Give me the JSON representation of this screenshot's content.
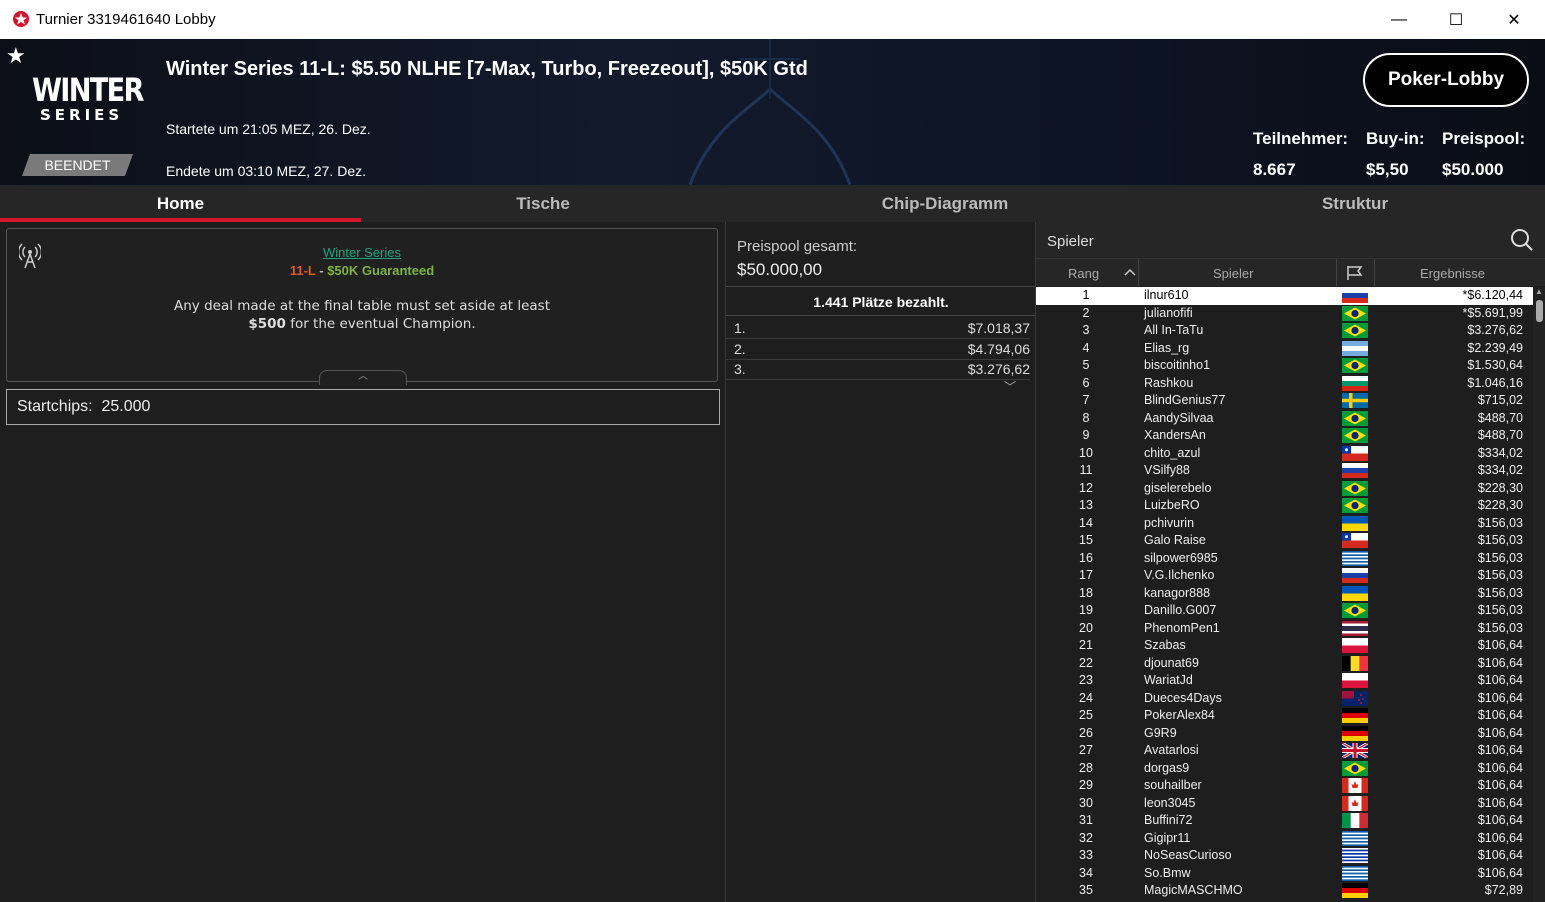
{
  "window": {
    "title": "Turnier 3319461640 Lobby",
    "minimize": "—",
    "maximize": "☐",
    "close": "✕"
  },
  "header": {
    "logo_line1": "WINTER",
    "logo_line2": "SERIES",
    "status_badge": "BEENDET",
    "tournament_title": "Winter Series 11-L: $5.50 NLHE [7-Max, Turbo, Freezeout], $50K Gtd",
    "started": "Startete um 21:05 MEZ, 26. Dez.",
    "ended": "Endete um 03:10 MEZ, 27. Dez.",
    "lobby_button": "Poker-Lobby",
    "stats": [
      {
        "label": "Teilnehmer:",
        "value": "8.667"
      },
      {
        "label": "Buy-in:",
        "value": "$5,50"
      },
      {
        "label": "Preispool:",
        "value": "$50.000"
      }
    ]
  },
  "tabs": [
    "Home",
    "Tische",
    "Chip-Diagramm",
    "Struktur"
  ],
  "home": {
    "series_link": "Winter Series",
    "event_num": "11-L",
    "sep": " - ",
    "guarantee": "$50K Guaranteed",
    "deal_line1": "Any deal made at the final table must set aside at least",
    "deal_amount": "$500",
    "deal_line2_rest": " for the eventual Champion.",
    "start_chips_label": "Startchips:",
    "start_chips_value": "25.000"
  },
  "prizepool": {
    "label": "Preispool gesamt:",
    "value": "$50.000,00",
    "places_paid": "1.441 Plätze bezahlt.",
    "payouts": [
      {
        "place": "1.",
        "amount": "$7.018,37"
      },
      {
        "place": "2.",
        "amount": "$4.794,06"
      },
      {
        "place": "3.",
        "amount": "$3.276,62"
      }
    ]
  },
  "players": {
    "search_placeholder": "Spieler",
    "columns": {
      "rank": "Rang",
      "player": "Spieler",
      "winnings": "Ergebnisse"
    },
    "rows": [
      {
        "rank": "1",
        "name": "ilnur610",
        "flag": "ru",
        "amount": "*$6.120,44"
      },
      {
        "rank": "2",
        "name": "julianofifi",
        "flag": "br",
        "amount": "*$5.691,99"
      },
      {
        "rank": "3",
        "name": "All In-TaTu",
        "flag": "br",
        "amount": "$3.276,62"
      },
      {
        "rank": "4",
        "name": "Elias_rg",
        "flag": "ar",
        "amount": "$2.239,49"
      },
      {
        "rank": "5",
        "name": "biscoitinho1",
        "flag": "br",
        "amount": "$1.530,64"
      },
      {
        "rank": "6",
        "name": "Rashkou",
        "flag": "bg",
        "amount": "$1.046,16"
      },
      {
        "rank": "7",
        "name": "BlindGenius77",
        "flag": "se",
        "amount": "$715,02"
      },
      {
        "rank": "8",
        "name": "AandySilvaa",
        "flag": "br",
        "amount": "$488,70"
      },
      {
        "rank": "9",
        "name": "XandersAn",
        "flag": "br",
        "amount": "$488,70"
      },
      {
        "rank": "10",
        "name": "chito_azul",
        "flag": "cl",
        "amount": "$334,02"
      },
      {
        "rank": "11",
        "name": "VSilfy88",
        "flag": "ru",
        "amount": "$334,02"
      },
      {
        "rank": "12",
        "name": "giselerebelo",
        "flag": "br",
        "amount": "$228,30"
      },
      {
        "rank": "13",
        "name": "LuizbeRO",
        "flag": "br",
        "amount": "$228,30"
      },
      {
        "rank": "14",
        "name": "pchivurin",
        "flag": "ua",
        "amount": "$156,03"
      },
      {
        "rank": "15",
        "name": "Galo Raise",
        "flag": "cl",
        "amount": "$156,03"
      },
      {
        "rank": "16",
        "name": "silpower6985",
        "flag": "gr",
        "amount": "$156,03"
      },
      {
        "rank": "17",
        "name": "V.G.Ilchenko",
        "flag": "ru",
        "amount": "$156,03"
      },
      {
        "rank": "18",
        "name": "kanagor888",
        "flag": "ua",
        "amount": "$156,03"
      },
      {
        "rank": "19",
        "name": "Danillo.G007",
        "flag": "br",
        "amount": "$156,03"
      },
      {
        "rank": "20",
        "name": "PhenomPen1",
        "flag": "th",
        "amount": "$156,03"
      },
      {
        "rank": "21",
        "name": "Szabas",
        "flag": "pl",
        "amount": "$106,64"
      },
      {
        "rank": "22",
        "name": "djounat69",
        "flag": "be",
        "amount": "$106,64"
      },
      {
        "rank": "23",
        "name": "WariatJd",
        "flag": "pl",
        "amount": "$106,64"
      },
      {
        "rank": "24",
        "name": "Dueces4Days",
        "flag": "nz",
        "amount": "$106,64"
      },
      {
        "rank": "25",
        "name": "PokerAlex84",
        "flag": "de",
        "amount": "$106,64"
      },
      {
        "rank": "26",
        "name": "G9R9",
        "flag": "de",
        "amount": "$106,64"
      },
      {
        "rank": "27",
        "name": "Avatarlosi",
        "flag": "gb",
        "amount": "$106,64"
      },
      {
        "rank": "28",
        "name": "dorgas9",
        "flag": "br",
        "amount": "$106,64"
      },
      {
        "rank": "29",
        "name": "souhailber",
        "flag": "ca",
        "amount": "$106,64"
      },
      {
        "rank": "30",
        "name": "leon3045",
        "flag": "ca",
        "amount": "$106,64"
      },
      {
        "rank": "31",
        "name": "Buffini72",
        "flag": "it",
        "amount": "$106,64"
      },
      {
        "rank": "32",
        "name": "Gigipr11",
        "flag": "gr",
        "amount": "$106,64"
      },
      {
        "rank": "33",
        "name": "NoSeasCurioso",
        "flag": "uy",
        "amount": "$106,64"
      },
      {
        "rank": "34",
        "name": "So.Bmw",
        "flag": "gr",
        "amount": "$106,64"
      },
      {
        "rank": "35",
        "name": "MagicMASCHMO",
        "flag": "de",
        "amount": "$72,89"
      }
    ]
  },
  "colors": {
    "accent_red": "#d3142a",
    "series_green": "#1fa37a",
    "event_orange": "#e0592a",
    "guarantee_green": "#7cb342"
  }
}
